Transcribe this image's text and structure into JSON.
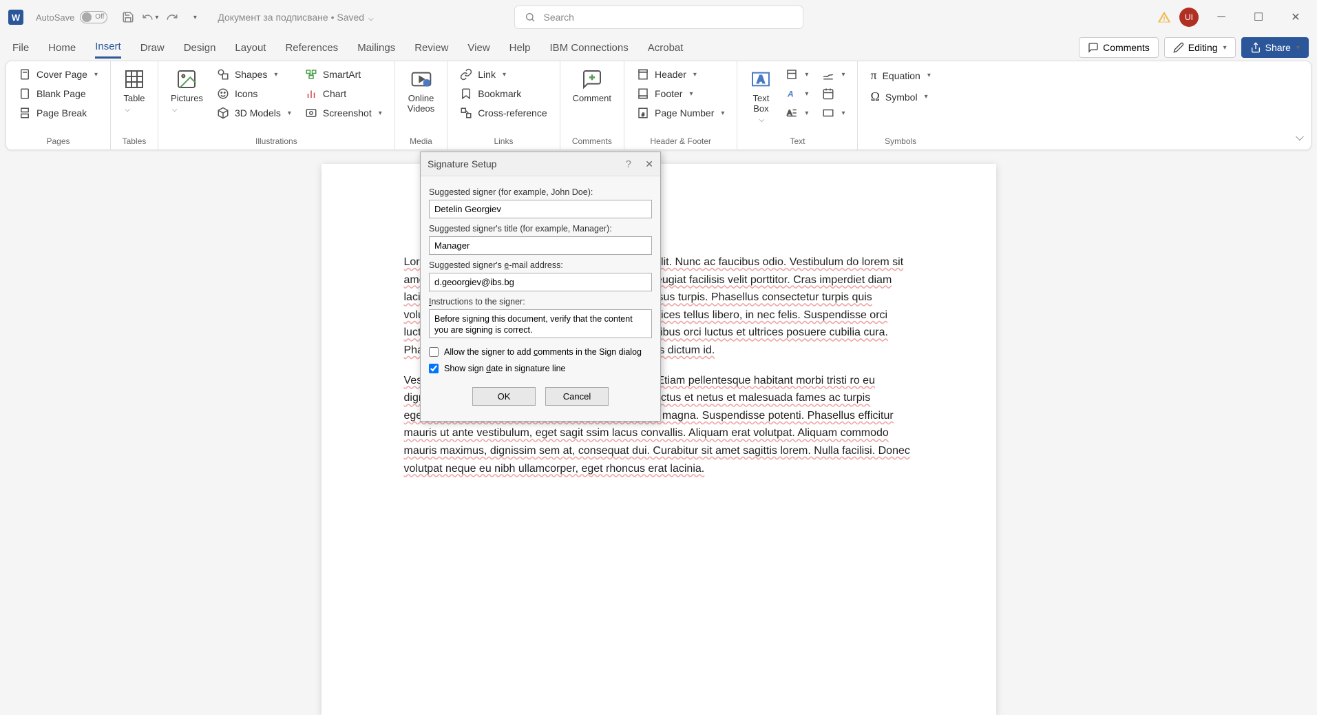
{
  "titlebar": {
    "autosave": "AutoSave",
    "toggle_off": "Off",
    "doc_title": "Документ за подписване • Saved",
    "search_placeholder": "Search",
    "user_initials": "UI"
  },
  "tabs": {
    "items": [
      "File",
      "Home",
      "Insert",
      "Draw",
      "Design",
      "Layout",
      "References",
      "Mailings",
      "Review",
      "View",
      "Help",
      "IBM Connections",
      "Acrobat"
    ],
    "active_index": 2,
    "comments": "Comments",
    "editing": "Editing",
    "share": "Share"
  },
  "ribbon": {
    "pages": {
      "label": "Pages",
      "cover": "Cover Page",
      "blank": "Blank Page",
      "break": "Page Break"
    },
    "tables": {
      "label": "Tables",
      "table": "Table"
    },
    "illustrations": {
      "label": "Illustrations",
      "pictures": "Pictures",
      "shapes": "Shapes",
      "icons": "Icons",
      "models": "3D Models",
      "smartart": "SmartArt",
      "chart": "Chart",
      "screenshot": "Screenshot"
    },
    "media": {
      "label": "Media",
      "videos": "Online\nVideos"
    },
    "links": {
      "label": "Links",
      "link": "Link",
      "bookmark": "Bookmark",
      "crossref": "Cross-reference"
    },
    "comments": {
      "label": "Comments",
      "comment": "Comment"
    },
    "headerfooter": {
      "label": "Header & Footer",
      "header": "Header",
      "footer": "Footer",
      "pagenum": "Page Number"
    },
    "text": {
      "label": "Text",
      "textbox": "Text\nBox"
    },
    "symbols": {
      "label": "Symbols",
      "equation": "Equation",
      "symbol": "Symbol"
    }
  },
  "document": {
    "p1": "Lorem ipsum dolor sit amet, consectetur adipiscing elit. Nunc ac faucibus odio. Vestibulum do lorem sit amet blandit dignissim. Suspendisse potenti. Nunc feugiat facilisis velit porttitor. Cras imperdiet diam lacinia vestibulum. Cras sed ultrices mauris, non cursus turpis. Phasellus consectetur turpis quis volutpat tristique ipsu, egestas eget libero. Fusce ultrices tellus libero, in nec felis. Suspendisse orci luctus et ultrices posuere cubilia ipsum primis in faucibus orci luctus et ultrices posuere cubilia cura. Phasellus consectetur turpis quis volutpat cursus felis dictum id.",
    "p2": "Vestibulum at sem tempus nisi ullamcorper efficitur. Etiam pellentesque habitant morbi tristi ro eu dignissim. Pellentesque habitant morbi tristique senectus et netus et malesuada fames ac turpis egestas. Sed id ac turpis egestas. Sed id vestibulum magna. Suspendisse potenti. Phasellus efficitur mauris ut ante vestibulum, eget sagit ssim lacus convallis. Aliquam erat volutpat. Aliquam commodo mauris maximus, dignissim sem at, consequat dui. Curabitur sit amet sagittis lorem. Nulla facilisi. Donec volutpat neque eu nibh ullamcorper, eget rhoncus erat lacinia."
  },
  "dialog": {
    "title": "Signature Setup",
    "signer_label": "Suggested signer (for example, John Doe):",
    "signer_value": "Detelin Georgiev",
    "title_label": "Suggested signer's title (for example, Manager):",
    "title_value": "Manager",
    "email_label_pre": "Suggested signer's ",
    "email_label_u": "e",
    "email_label_post": "-mail address:",
    "email_value": "d.geoorgiev@ibs.bg",
    "instr_label_u": "I",
    "instr_label_post": "nstructions to the signer:",
    "instr_value": "Before signing this document, verify that the content you are signing is correct.",
    "allow_pre": "Allow the signer to add ",
    "allow_u": "c",
    "allow_post": "omments in the Sign dialog",
    "showdate_pre": "Show sign ",
    "showdate_u": "d",
    "showdate_post": "ate in signature line",
    "ok": "OK",
    "cancel": "Cancel"
  }
}
